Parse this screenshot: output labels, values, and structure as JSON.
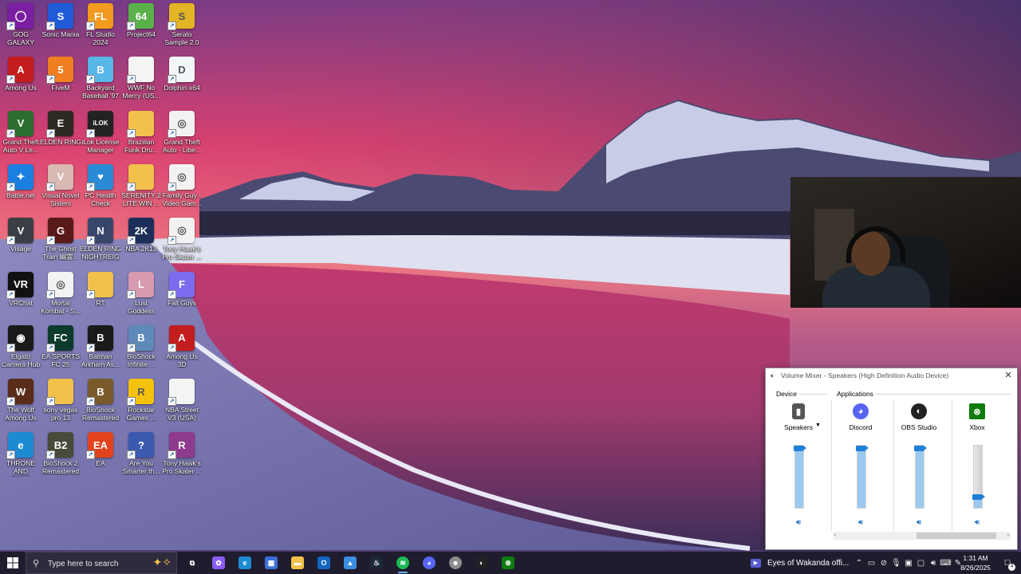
{
  "desktop": {
    "icons": [
      {
        "label": "GOG GALAXY",
        "icon": "gog-galaxy-icon",
        "color": "#7b1fa2",
        "glyph": "◯"
      },
      {
        "label": "Sonic Mania",
        "icon": "sonic-mania-icon",
        "color": "#1f5bd6",
        "glyph": "S"
      },
      {
        "label": "FL Studio 2024",
        "icon": "fl-studio-icon",
        "color": "#f29b1f",
        "glyph": "FL"
      },
      {
        "label": "Project64",
        "icon": "project64-icon",
        "color": "#5ab14a",
        "glyph": "64"
      },
      {
        "label": "Serato Sample 2.0",
        "icon": "serato-icon",
        "color": "#e3b424",
        "glyph": "S"
      },
      {
        "label": "Among Us",
        "icon": "among-us-icon",
        "color": "#c31d1d",
        "glyph": "A"
      },
      {
        "label": "FiveM",
        "icon": "fivem-icon",
        "color": "#f07f22",
        "glyph": "5"
      },
      {
        "label": "Backyard Baseball '97",
        "icon": "backyard-baseball-icon",
        "color": "#58b6e8",
        "glyph": "B"
      },
      {
        "label": "WWF No Mercy (US...",
        "icon": "file-icon",
        "color": "#f4f4f4",
        "glyph": ""
      },
      {
        "label": "Dolphin-x64",
        "icon": "dolphin-icon",
        "color": "#f3f6f8",
        "glyph": "D"
      },
      {
        "label": "Grand Theft Auto V Le...",
        "icon": "gta-v-icon",
        "color": "#2b6e2e",
        "glyph": "V"
      },
      {
        "label": "ELDEN RING",
        "icon": "elden-ring-icon",
        "color": "#2d2a22",
        "glyph": "E"
      },
      {
        "label": "iLok License Manager",
        "icon": "ilok-icon",
        "color": "#222222",
        "glyph": "iLOK"
      },
      {
        "label": "Brazilian Funk Dru...",
        "icon": "zip-folder-icon",
        "color": "#f2c14b",
        "glyph": ""
      },
      {
        "label": "Grand Theft Auto - Libe...",
        "icon": "disc-image-icon",
        "color": "#f2f2f2",
        "glyph": "◎"
      },
      {
        "label": "Battle.net",
        "icon": "battle-net-icon",
        "color": "#1a7fe0",
        "glyph": "✦"
      },
      {
        "label": "Visual Novel Sisters",
        "icon": "visual-novel-icon",
        "color": "#d8b9b3",
        "glyph": "V"
      },
      {
        "label": "PC Health Check",
        "icon": "pc-health-check-icon",
        "color": "#2a8ad6",
        "glyph": "♥"
      },
      {
        "label": "SERENITY 2 LITE WIN ...",
        "icon": "zip-folder-icon",
        "color": "#f2c14b",
        "glyph": ""
      },
      {
        "label": "Family Guy - Video Gam...",
        "icon": "disc-image-icon",
        "color": "#f2f2f2",
        "glyph": "◎"
      },
      {
        "label": "Visage",
        "icon": "visage-icon",
        "color": "#3a3f45",
        "glyph": "V"
      },
      {
        "label": "The Ghost Train 幽霊...",
        "icon": "ghost-train-icon",
        "color": "#5a1a1a",
        "glyph": "G"
      },
      {
        "label": "ELDEN RING NIGHTREIGN",
        "icon": "elden-ring-nightreign-icon",
        "color": "#39466b",
        "glyph": "N"
      },
      {
        "label": "NBA 2K13",
        "icon": "nba-2k13-icon",
        "color": "#1c2f5a",
        "glyph": "2K"
      },
      {
        "label": "Tony Hawk's Pro Skater ...",
        "icon": "disc-image-icon",
        "color": "#f2f2f2",
        "glyph": "◎"
      },
      {
        "label": "VRChat",
        "icon": "vrchat-icon",
        "color": "#111111",
        "glyph": "VR"
      },
      {
        "label": "Mortal Kombat - S...",
        "icon": "disc-image-icon",
        "color": "#f2f2f2",
        "glyph": "◎"
      },
      {
        "label": "RT",
        "icon": "folder-icon",
        "color": "#f2c14b",
        "glyph": ""
      },
      {
        "label": "Lust Goddess",
        "icon": "lust-goddess-icon",
        "color": "#d89ab0",
        "glyph": "L"
      },
      {
        "label": "Fall Guys",
        "icon": "fall-guys-icon",
        "color": "#7b6cf0",
        "glyph": "F"
      },
      {
        "label": "Elgato Camera Hub",
        "icon": "elgato-icon",
        "color": "#1a1a1a",
        "glyph": "◉"
      },
      {
        "label": "EA SPORTS FC 25",
        "icon": "ea-fc-icon",
        "color": "#0c3b2e",
        "glyph": "FC"
      },
      {
        "label": "Batman Arkham As...",
        "icon": "batman-icon",
        "color": "#1a1a1a",
        "glyph": "B"
      },
      {
        "label": "BioShock Infinite ...",
        "icon": "bioshock-infinite-icon",
        "color": "#5e89b8",
        "glyph": "B"
      },
      {
        "label": "Among Us 3D",
        "icon": "among-us-3d-icon",
        "color": "#c31d1d",
        "glyph": "A"
      },
      {
        "label": "The Wolf Among Us",
        "icon": "wolf-among-us-icon",
        "color": "#5a2c1a",
        "glyph": "W"
      },
      {
        "label": "sony vegas pro 13",
        "icon": "zip-folder-icon",
        "color": "#f2c14b",
        "glyph": ""
      },
      {
        "label": "BioShock Remastered",
        "icon": "bioshock-icon",
        "color": "#7a5a2a",
        "glyph": "B"
      },
      {
        "label": "Rockstar Games ...",
        "icon": "rockstar-icon",
        "color": "#f4c20d",
        "glyph": "R"
      },
      {
        "label": "NBA Street V3 (USA)",
        "icon": "file-icon",
        "color": "#f4f4f4",
        "glyph": ""
      },
      {
        "label": "THRONE AND LIBERT...",
        "icon": "edge-icon",
        "color": "#1d8bd1",
        "glyph": "e"
      },
      {
        "label": "BioShock 2 Remastered",
        "icon": "bioshock-2-icon",
        "color": "#4a4a3a",
        "glyph": "B2"
      },
      {
        "label": "EA",
        "icon": "ea-icon",
        "color": "#e2431d",
        "glyph": "EA"
      },
      {
        "label": "Are You Smarter th...",
        "icon": "are-you-smarter-icon",
        "color": "#3a5ab0",
        "glyph": "?"
      },
      {
        "label": "Tony Hawk's Pro Skater ...",
        "icon": "winrar-icon",
        "color": "#8e3a8e",
        "glyph": "R"
      }
    ]
  },
  "mixer": {
    "title": "Volume Mixer - Speakers (High Definition Audio Device)",
    "device_label": "Device",
    "applications_label": "Applications",
    "channels": [
      {
        "name": "Speakers",
        "icon": "speaker-device-icon",
        "color": "#555555",
        "glyph": "▮",
        "level": 1.0,
        "has_dropdown": true
      },
      {
        "name": "Discord",
        "icon": "discord-icon",
        "color": "#5865f2",
        "glyph": "◕",
        "level": 1.0,
        "has_dropdown": false
      },
      {
        "name": "OBS Studio",
        "icon": "obs-studio-icon",
        "color": "#222222",
        "glyph": "◐",
        "level": 1.0,
        "has_dropdown": false
      },
      {
        "name": "Xbox",
        "icon": "xbox-icon",
        "color": "#107c10",
        "glyph": "⊗",
        "level": 0.14,
        "has_dropdown": false
      }
    ]
  },
  "taskbar": {
    "search_placeholder": "Type here to search",
    "apps": [
      {
        "icon": "task-view-icon",
        "color": "transparent",
        "glyph": "⧉",
        "active": false
      },
      {
        "icon": "copilot-icon",
        "color": "#8a5cf6",
        "glyph": "✿",
        "active": false
      },
      {
        "icon": "edge-icon",
        "color": "#1d8bd1",
        "glyph": "e",
        "active": false
      },
      {
        "icon": "microsoft-store-icon",
        "color": "#3b6fd8",
        "glyph": "▦",
        "active": false
      },
      {
        "icon": "file-explorer-icon",
        "color": "#f2c14b",
        "glyph": "▬",
        "active": false
      },
      {
        "icon": "outlook-icon",
        "color": "#1265c0",
        "glyph": "O",
        "active": false
      },
      {
        "icon": "photos-icon",
        "color": "#3a8fe0",
        "glyph": "▲",
        "active": false
      },
      {
        "icon": "steam-icon",
        "color": "#1b2838",
        "glyph": "♨",
        "active": false
      },
      {
        "icon": "spotify-icon",
        "color": "#1db954",
        "glyph": "≋",
        "active": true
      },
      {
        "icon": "discord-icon",
        "color": "#5865f2",
        "glyph": "◕",
        "active": false
      },
      {
        "icon": "elden-ring-mask-icon",
        "color": "#8c8c8c",
        "glyph": "☻",
        "active": false
      },
      {
        "icon": "obs-studio-icon",
        "color": "#222222",
        "glyph": "◐",
        "active": false
      },
      {
        "icon": "xbox-icon",
        "color": "#107c10",
        "glyph": "⊗",
        "active": false
      }
    ],
    "media_title": "Eyes of Wakanda offi...",
    "tray_icons": [
      "chevron-up-icon",
      "meet-now-icon",
      "network-off-icon",
      "microphone-icon",
      "display-icon",
      "screen-icon",
      "volume-icon",
      "language-icon",
      "pen-icon"
    ],
    "clock_time": "1:31 AM",
    "clock_date": "8/26/2025",
    "notification_count": "4"
  }
}
